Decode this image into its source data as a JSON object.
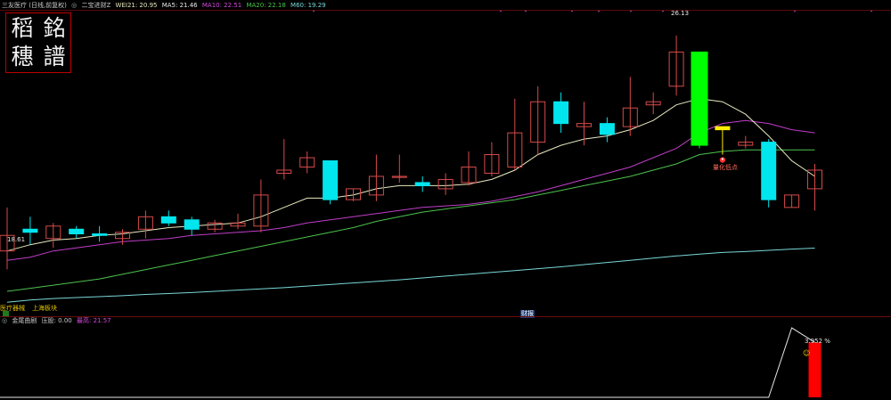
{
  "header": {
    "stock_name": "三友医疗 (日线,前复权)",
    "indicator_icon": "settings-icon",
    "indicator_name": "二宝进财Z",
    "wei21": "WEI21: 20.95",
    "ma5": "MA5: 21.46",
    "ma10": "MA10: 22.51",
    "ma20": "MA20: 22.18",
    "ma60": "M60: 19.29"
  },
  "seal_text": [
    "稻",
    "銘",
    "穗",
    "譜"
  ],
  "tags": {
    "sector1": "医疗器械",
    "sector2": "上海板块",
    "event": "财报",
    "quant_low": "量化低点",
    "peak_value": "26.13",
    "low_value": "18.61",
    "sub_value": "3.952 %"
  },
  "sub_header": {
    "icon": "settings-icon",
    "indicator_name": "金尾曲剧",
    "risk": "压股: 0.00",
    "top": "最高: 21.57"
  },
  "colors": {
    "up": "#d64a4a",
    "down": "#00e5ee",
    "big_bar": "#00ff00",
    "wei21": "#e8e8c0",
    "ma10": "#c03ec8",
    "ma20": "#4cc24c",
    "ma60": "#7ad7d7",
    "sub_line": "#e6e6e6",
    "sub_bar": "#ff0000"
  },
  "chart_data": [
    {
      "type": "candlestick",
      "price_range": [
        17.5,
        26.5
      ],
      "candles": [
        {
          "o": 19.7,
          "h": 20.6,
          "l": 18.61,
          "c": 19.2,
          "color": "up"
        },
        {
          "o": 19.9,
          "h": 20.3,
          "l": 19.4,
          "c": 19.8,
          "color": "down"
        },
        {
          "o": 19.6,
          "h": 20.1,
          "l": 19.3,
          "c": 20.0,
          "color": "up"
        },
        {
          "o": 19.9,
          "h": 20.0,
          "l": 19.6,
          "c": 19.75,
          "color": "down"
        },
        {
          "o": 19.75,
          "h": 20.0,
          "l": 19.5,
          "c": 19.7,
          "color": "down"
        },
        {
          "o": 19.6,
          "h": 19.9,
          "l": 19.4,
          "c": 19.8,
          "color": "up"
        },
        {
          "o": 19.9,
          "h": 20.5,
          "l": 19.6,
          "c": 20.3,
          "color": "up"
        },
        {
          "o": 20.3,
          "h": 20.5,
          "l": 20.0,
          "c": 20.1,
          "color": "down"
        },
        {
          "o": 20.2,
          "h": 20.3,
          "l": 19.7,
          "c": 19.9,
          "color": "down"
        },
        {
          "o": 19.9,
          "h": 20.2,
          "l": 19.8,
          "c": 20.1,
          "color": "up"
        },
        {
          "o": 20.0,
          "h": 20.4,
          "l": 19.9,
          "c": 20.1,
          "color": "up"
        },
        {
          "o": 20.0,
          "h": 21.5,
          "l": 19.8,
          "c": 21.0,
          "color": "up"
        },
        {
          "o": 21.7,
          "h": 22.8,
          "l": 21.5,
          "c": 21.8,
          "color": "up"
        },
        {
          "o": 21.9,
          "h": 22.4,
          "l": 21.7,
          "c": 22.2,
          "color": "up"
        },
        {
          "o": 22.1,
          "h": 22.1,
          "l": 20.7,
          "c": 20.85,
          "color": "down"
        },
        {
          "o": 20.85,
          "h": 21.2,
          "l": 20.8,
          "c": 21.2,
          "color": "up"
        },
        {
          "o": 21.0,
          "h": 22.3,
          "l": 20.8,
          "c": 21.6,
          "color": "up"
        },
        {
          "o": 21.6,
          "h": 22.3,
          "l": 21.4,
          "c": 21.6,
          "color": "up"
        },
        {
          "o": 21.4,
          "h": 21.6,
          "l": 21.1,
          "c": 21.3,
          "color": "down"
        },
        {
          "o": 21.2,
          "h": 21.7,
          "l": 21.0,
          "c": 21.5,
          "color": "up"
        },
        {
          "o": 21.4,
          "h": 22.4,
          "l": 21.3,
          "c": 21.9,
          "color": "up"
        },
        {
          "o": 21.7,
          "h": 22.7,
          "l": 21.6,
          "c": 22.3,
          "color": "up"
        },
        {
          "o": 21.9,
          "h": 24.1,
          "l": 21.8,
          "c": 23.0,
          "color": "up"
        },
        {
          "o": 22.7,
          "h": 24.5,
          "l": 22.3,
          "c": 24.0,
          "color": "up"
        },
        {
          "o": 24.0,
          "h": 24.3,
          "l": 23.0,
          "c": 23.3,
          "color": "down"
        },
        {
          "o": 23.2,
          "h": 24.0,
          "l": 22.6,
          "c": 23.3,
          "color": "up"
        },
        {
          "o": 23.3,
          "h": 23.5,
          "l": 22.7,
          "c": 22.95,
          "color": "down"
        },
        {
          "o": 23.2,
          "h": 24.8,
          "l": 22.9,
          "c": 23.8,
          "color": "up"
        },
        {
          "o": 23.9,
          "h": 24.3,
          "l": 23.6,
          "c": 24.0,
          "color": "up"
        },
        {
          "o": 24.5,
          "h": 26.13,
          "l": 24.2,
          "c": 25.6,
          "color": "up"
        },
        {
          "o": 25.6,
          "h": 25.6,
          "l": 22.5,
          "c": 22.6,
          "color": "big_bar"
        },
        {
          "o": 23.2,
          "h": 23.2,
          "l": 22.3,
          "c": 23.1,
          "color": "mixed"
        },
        {
          "o": 22.7,
          "h": 22.9,
          "l": 22.5,
          "c": 22.6,
          "color": "up"
        },
        {
          "o": 22.7,
          "h": 22.8,
          "l": 20.6,
          "c": 20.85,
          "color": "down"
        },
        {
          "o": 20.6,
          "h": 21.0,
          "l": 20.6,
          "c": 21.0,
          "color": "up"
        },
        {
          "o": 21.2,
          "h": 22.0,
          "l": 20.5,
          "c": 21.8,
          "color": "up"
        }
      ],
      "wei21": [
        19.2,
        19.4,
        19.55,
        19.6,
        19.7,
        19.75,
        19.85,
        19.95,
        20.0,
        20.05,
        20.1,
        20.3,
        20.6,
        20.9,
        20.9,
        21.0,
        21.2,
        21.3,
        21.3,
        21.3,
        21.35,
        21.5,
        21.8,
        22.3,
        22.6,
        22.8,
        22.9,
        23.1,
        23.4,
        23.9,
        24.1,
        24.0,
        23.6,
        22.9,
        22.1,
        21.6
      ],
      "ma10": [
        18.9,
        19.0,
        19.2,
        19.3,
        19.4,
        19.5,
        19.55,
        19.6,
        19.7,
        19.75,
        19.8,
        19.85,
        19.95,
        20.1,
        20.2,
        20.3,
        20.4,
        20.5,
        20.6,
        20.65,
        20.7,
        20.8,
        20.95,
        21.1,
        21.3,
        21.5,
        21.7,
        21.9,
        22.2,
        22.5,
        23.0,
        23.3,
        23.4,
        23.3,
        23.1,
        23.0
      ],
      "ma20": [
        17.9,
        18.0,
        18.1,
        18.2,
        18.3,
        18.45,
        18.6,
        18.75,
        18.9,
        19.05,
        19.2,
        19.35,
        19.5,
        19.65,
        19.8,
        19.95,
        20.15,
        20.3,
        20.45,
        20.55,
        20.65,
        20.75,
        20.85,
        21.0,
        21.15,
        21.3,
        21.45,
        21.6,
        21.8,
        22.0,
        22.3,
        22.4,
        22.45,
        22.45,
        22.45,
        22.45
      ],
      "ma60": [
        17.55,
        17.62,
        17.67,
        17.7,
        17.73,
        17.76,
        17.8,
        17.83,
        17.86,
        17.9,
        17.94,
        17.98,
        18.02,
        18.07,
        18.12,
        18.17,
        18.22,
        18.27,
        18.33,
        18.39,
        18.45,
        18.51,
        18.57,
        18.63,
        18.69,
        18.76,
        18.83,
        18.9,
        18.97,
        19.04,
        19.1,
        19.15,
        19.18,
        19.22,
        19.26,
        19.29
      ]
    },
    {
      "type": "line",
      "y_range": [
        0,
        5
      ],
      "line": [
        0,
        0,
        0,
        0,
        0,
        0,
        0,
        0,
        0,
        0,
        0,
        0,
        0,
        0,
        0,
        0,
        0,
        0,
        0,
        0,
        0,
        0,
        0,
        0,
        0,
        0,
        0,
        0,
        0,
        0,
        0,
        0,
        0,
        0,
        5,
        3.952
      ],
      "bar_index": 35,
      "bar_value": 3.952
    }
  ]
}
